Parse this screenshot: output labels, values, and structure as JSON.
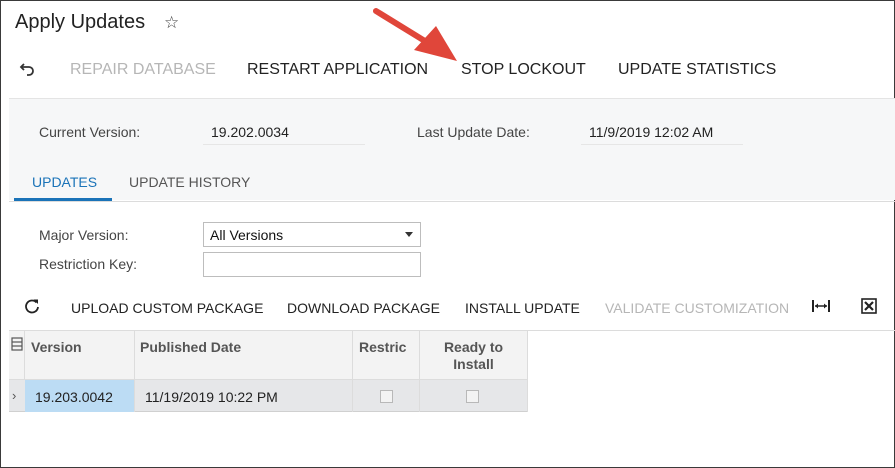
{
  "header": {
    "title": "Apply Updates",
    "favorite_icon": "star-outline-icon"
  },
  "toolbar": {
    "undo_icon": "undo-icon",
    "repair_database": "REPAIR DATABASE",
    "restart_application": "RESTART APPLICATION",
    "stop_lockout": "STOP LOCKOUT",
    "update_statistics": "UPDATE STATISTICS"
  },
  "summary": {
    "current_version_label": "Current Version:",
    "current_version_value": "19.202.0034",
    "last_update_label": "Last Update Date:",
    "last_update_value": "11/9/2019 12:02 AM"
  },
  "tabs": {
    "updates": "UPDATES",
    "update_history": "UPDATE HISTORY"
  },
  "filters": {
    "major_version_label": "Major Version:",
    "major_version_value": "All Versions",
    "restriction_key_label": "Restriction Key:",
    "restriction_key_value": ""
  },
  "grid_toolbar": {
    "refresh_icon": "refresh-icon",
    "upload_custom_package": "UPLOAD CUSTOM PACKAGE",
    "download_package": "DOWNLOAD PACKAGE",
    "install_update": "INSTALL UPDATE",
    "validate_customization": "VALIDATE CUSTOMIZATION",
    "fit_columns_icon": "fit-columns-icon",
    "export_excel_icon": "excel-export-icon"
  },
  "grid": {
    "columns": [
      "Version",
      "Published Date",
      "Restric",
      "Ready to Install"
    ],
    "rows": [
      {
        "version": "19.203.0042",
        "published_date": "11/19/2019 10:22 PM",
        "restricted": false,
        "ready_to_install": false
      }
    ]
  },
  "colors": {
    "accent": "#1a73b8",
    "annotation_arrow": "#e0463a",
    "selected_cell": "#bcdcf4"
  }
}
